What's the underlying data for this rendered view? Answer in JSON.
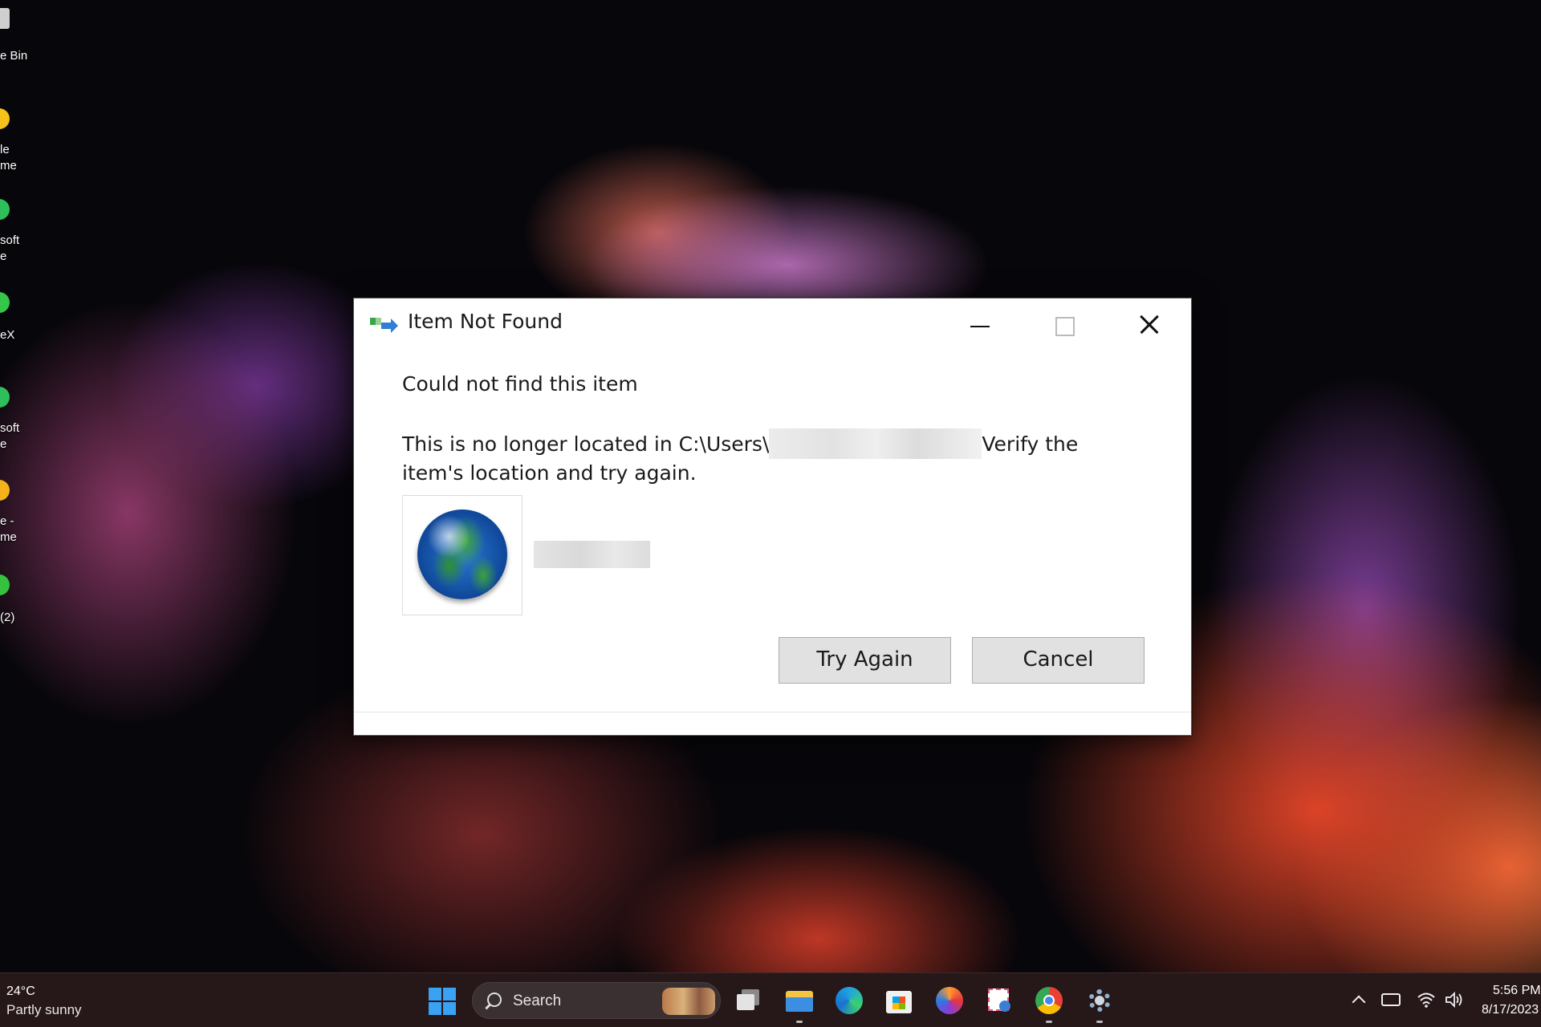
{
  "desktop": {
    "icons": [
      {
        "label": "e Bin",
        "color": "#cfcfcf"
      },
      {
        "label": "le\nme",
        "color": "#f4c21a"
      },
      {
        "label": "soft\ne",
        "color": "#2fbf5a"
      },
      {
        "label": "eX",
        "color": "#35c74a"
      },
      {
        "label": "soft\ne",
        "color": "#2fbf5a"
      },
      {
        "label": "e -\nme",
        "color": "#f4b31a"
      },
      {
        "label": "(2)",
        "color": "#36c23f"
      }
    ]
  },
  "dialog": {
    "title": "Item Not Found",
    "heading": "Could not find this item",
    "message_before": "This is no longer located in C:\\Users\\",
    "message_after": "Verify the item's location and try again.",
    "buttons": {
      "try_again": "Try Again",
      "cancel": "Cancel"
    },
    "icon": "globe-icon"
  },
  "taskbar": {
    "weather": {
      "temperature": "24°C",
      "description": "Partly sunny"
    },
    "search": {
      "placeholder": "Search"
    },
    "apps": [
      {
        "name": "task-view",
        "icon": "task-view-icon",
        "color": "#d0d0d0"
      },
      {
        "name": "file-explorer",
        "icon": "folder-icon",
        "color": "#f5c542"
      },
      {
        "name": "edge",
        "icon": "edge-icon",
        "color": "#1fa3e0"
      },
      {
        "name": "microsoft-store",
        "icon": "store-icon",
        "color": "#2a7ad6"
      },
      {
        "name": "firefox",
        "icon": "firefox-icon",
        "color": "#e55b2d"
      },
      {
        "name": "snipping-tool",
        "icon": "snipping-tool-icon",
        "color": "#e05a7a"
      },
      {
        "name": "chrome",
        "icon": "chrome-icon",
        "color": "#e94235"
      },
      {
        "name": "settings",
        "icon": "settings-icon",
        "color": "#8fb0d0"
      }
    ],
    "clock": {
      "time": "5:56 PM",
      "date": "8/17/2023"
    }
  }
}
